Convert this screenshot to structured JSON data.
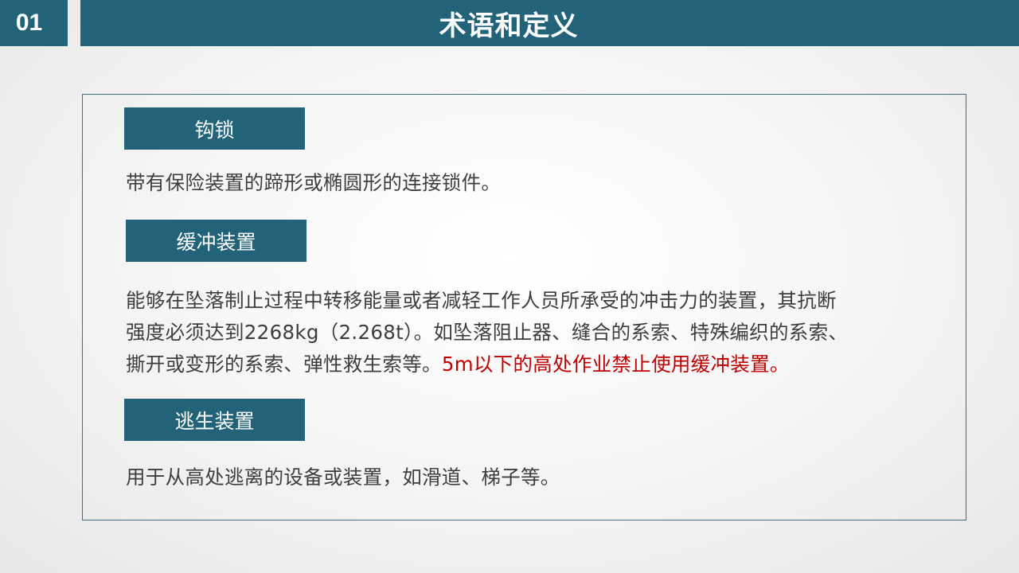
{
  "header": {
    "section_number": "01",
    "title": "术语和定义"
  },
  "terms": [
    {
      "label": "钩锁",
      "description_lines": [
        "带有保险装置的蹄形或椭圆形的连接锁件。"
      ]
    },
    {
      "label": "缓冲装置",
      "description_lines": [
        "能够在坠落制止过程中转移能量或者减轻工作人员所承受的冲击力的装置，其抗断",
        "强度必须达到2268kg（2.268t）。如坠落阻止器、缝合的系索、特殊编织的系索、",
        "撕开或变形的系索、弹性救生索等。"
      ],
      "warning": "5m以下的高处作业禁止使用缓冲装置。"
    },
    {
      "label": "逃生装置",
      "description_lines": [
        "用于从高处逃离的设备或装置，如滑道、梯子等。"
      ]
    }
  ],
  "colors": {
    "accent": "#22637a",
    "text": "#3e3e3e",
    "warning": "#c00000"
  }
}
